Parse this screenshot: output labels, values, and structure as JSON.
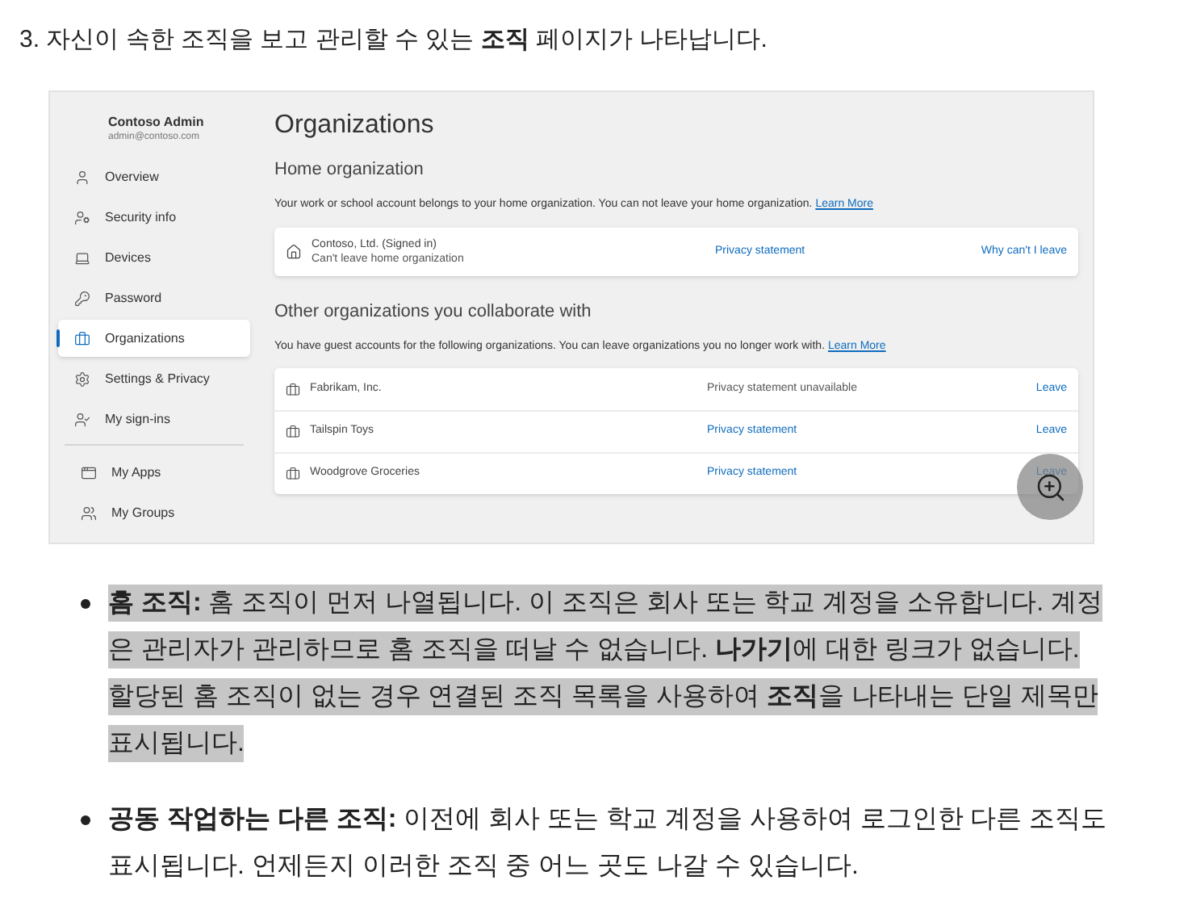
{
  "step": {
    "number": "3.",
    "text": "자신이 속한 조직을 보고 관리할 수 있는 **조직** 페이지가 나타납니다."
  },
  "screenshot": {
    "user": {
      "name": "Contoso Admin",
      "email": "admin@contoso.com"
    },
    "nav_groups": [
      [
        {
          "label": "Overview",
          "kind": "person",
          "selected": false
        },
        {
          "label": "Security info",
          "kind": "security",
          "selected": false
        },
        {
          "label": "Devices",
          "kind": "device",
          "selected": false
        },
        {
          "label": "Password",
          "kind": "key",
          "selected": false
        },
        {
          "label": "Organizations",
          "kind": "briefcase",
          "selected": true
        },
        {
          "label": "Settings & Privacy",
          "kind": "gear",
          "selected": false
        },
        {
          "label": "My sign-ins",
          "kind": "signin",
          "selected": false
        }
      ],
      [
        {
          "label": "My Apps",
          "kind": "apps",
          "selected": false
        },
        {
          "label": "My Groups",
          "kind": "groups",
          "selected": false
        }
      ]
    ],
    "title": "Organizations",
    "home": {
      "heading": "Home organization",
      "description": "Your work or school account belongs to your home organization. You can not leave your home organization.",
      "link": "Learn More",
      "org": {
        "name": "Contoso, Ltd. (Signed in)",
        "note": "Can't leave home organization",
        "privacy": "Privacy statement",
        "action": "Why can't I leave"
      }
    },
    "other": {
      "heading": "Other organizations you collaborate with",
      "description": "You have guest accounts for the following organizations. You can leave organizations you no longer work with.",
      "link": "Learn More",
      "orgs": [
        {
          "name": "Fabrikam, Inc.",
          "privacy": "Privacy statement unavailable",
          "privacy_available": false,
          "action": "Leave"
        },
        {
          "name": "Tailspin Toys",
          "privacy": "Privacy statement",
          "privacy_available": true,
          "action": "Leave"
        },
        {
          "name": "Woodgrove Groceries",
          "privacy": "Privacy statement",
          "privacy_available": true,
          "action": "Leave"
        }
      ]
    }
  },
  "bullets": [
    {
      "text": "**홈 조직:** 홈 조직이 먼저 나열됩니다. 이 조직은 회사 또는 학교 계정을 소유합니다. 계정은 관리자가 관리하므로 홈 조직을 떠날 수 없습니다. **나가기**에 대한 링크가 없습니다. 할당된 홈 조직이 없는 경우 연결된 조직 목록을 사용하여 **조직**을 나타내는 단일 제목만 표시됩니다.",
      "highlighted": true
    },
    {
      "text": "**공동 작업하는 다른 조직:** 이전에 회사 또는 학교 계정을 사용하여 로그인한 다른 조직도 표시됩니다. 언제든지 이러한 조직 중 어느 곳도 나갈 수 있습니다.",
      "highlighted": false
    }
  ]
}
